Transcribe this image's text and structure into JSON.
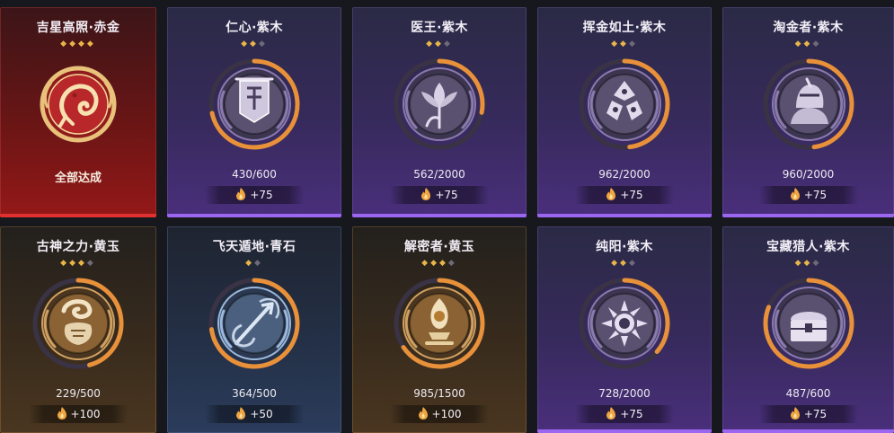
{
  "cards": [
    {
      "title": "吉星高照·赤金",
      "stars_on": 4,
      "stars_total": 4,
      "progress": "",
      "reward": "",
      "complete": "全部达成",
      "theme": "red",
      "icon": "koi-fish-icon",
      "fill": 1.0
    },
    {
      "title": "仁心·紫木",
      "stars_on": 2,
      "stars_total": 3,
      "progress": "430/600",
      "reward": "+75",
      "complete": "",
      "theme": "purple",
      "icon": "banner-icon",
      "fill": 0.7167
    },
    {
      "title": "医王·紫木",
      "stars_on": 2,
      "stars_total": 3,
      "progress": "562/2000",
      "reward": "+75",
      "complete": "",
      "theme": "purple",
      "icon": "lotus-icon",
      "fill": 0.281
    },
    {
      "title": "挥金如土·紫木",
      "stars_on": 2,
      "stars_total": 3,
      "progress": "962/2000",
      "reward": "+75",
      "complete": "",
      "theme": "purple",
      "icon": "coin-pile-icon",
      "fill": 0.481
    },
    {
      "title": "淘金者·紫木",
      "stars_on": 2,
      "stars_total": 3,
      "progress": "960/2000",
      "reward": "+75",
      "complete": "",
      "theme": "purple",
      "icon": "prospector-icon",
      "fill": 0.48
    },
    {
      "title": "古神之力·黄玉",
      "stars_on": 3,
      "stars_total": 4,
      "progress": "229/500",
      "reward": "+100",
      "complete": "",
      "theme": "gold",
      "icon": "ancient-god-icon",
      "fill": 0.458
    },
    {
      "title": "飞天遁地·青石",
      "stars_on": 1,
      "stars_total": 2,
      "progress": "364/500",
      "reward": "+50",
      "complete": "",
      "theme": "blue",
      "icon": "trident-icon",
      "fill": 0.728
    },
    {
      "title": "解密者·黄玉",
      "stars_on": 3,
      "stars_total": 4,
      "progress": "985/1500",
      "reward": "+100",
      "complete": "",
      "theme": "gold",
      "icon": "relic-icon",
      "fill": 0.6567
    },
    {
      "title": "纯阳·紫木",
      "stars_on": 2,
      "stars_total": 3,
      "progress": "728/2000",
      "reward": "+75",
      "complete": "",
      "theme": "purple",
      "icon": "sun-icon",
      "fill": 0.364
    },
    {
      "title": "宝藏猎人·紫木",
      "stars_on": 2,
      "stars_total": 3,
      "progress": "487/600",
      "reward": "+75",
      "complete": "",
      "theme": "purple",
      "icon": "treasure-chest-icon",
      "fill": 0.8117
    }
  ],
  "colors": {
    "ring_progress": "#e8913a",
    "ring_track": "#3a3346",
    "star_on": "#e8b54a",
    "star_off": "#6f6a78"
  }
}
